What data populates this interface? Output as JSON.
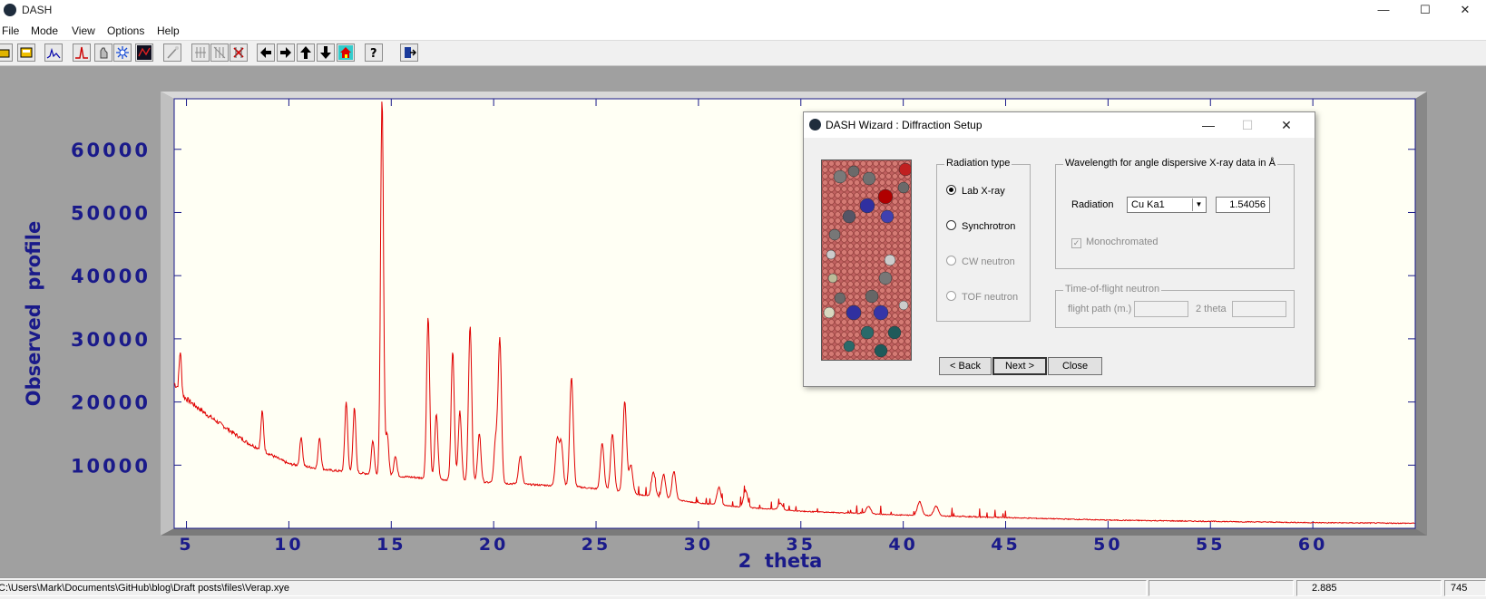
{
  "window": {
    "title": "DASH",
    "minimize": "—",
    "maximize": "☐",
    "close": "✕"
  },
  "menu": [
    "File",
    "Mode",
    "View",
    "Options",
    "Help"
  ],
  "toolbar": {
    "icons": [
      "open-folder-icon",
      "open-file-icon",
      "profile-chart-icon",
      "peak-fit-icon",
      "pawley-icon",
      "crystal-structure-icon",
      "structure-view-icon",
      "wand-icon",
      "grid-icon",
      "grid-cancel-icon",
      "grid-delete-icon",
      "arrow-left-icon",
      "arrow-right-icon",
      "arrow-up-icon",
      "arrow-down-icon",
      "home-icon",
      "help-icon",
      "exit-icon"
    ]
  },
  "chart_data": {
    "type": "line",
    "xlabel": "2  theta",
    "ylabel": "Observed  profile",
    "xlim": [
      4.4,
      65
    ],
    "ylim": [
      0,
      68000
    ],
    "xticks": [
      "5",
      "10",
      "15",
      "20",
      "25",
      "30",
      "35",
      "40",
      "45",
      "50",
      "55",
      "60"
    ],
    "yticks": [
      "10000",
      "20000",
      "30000",
      "40000",
      "50000",
      "60000"
    ],
    "series": [
      {
        "color": "#e00000",
        "background": [
          [
            4.4,
            23000
          ],
          [
            4.8,
            21000
          ],
          [
            6,
            18000
          ],
          [
            8,
            13500
          ],
          [
            10,
            10200
          ],
          [
            12,
            9200
          ],
          [
            14,
            8600
          ],
          [
            16,
            8100
          ],
          [
            18,
            7600
          ],
          [
            20,
            7200
          ],
          [
            22,
            6900
          ],
          [
            24,
            6600
          ],
          [
            26,
            5900
          ],
          [
            28,
            4900
          ],
          [
            30,
            4000
          ],
          [
            32,
            3400
          ],
          [
            35,
            2700
          ],
          [
            40,
            2100
          ],
          [
            45,
            1700
          ],
          [
            50,
            1300
          ],
          [
            55,
            1100
          ],
          [
            60,
            900
          ],
          [
            65,
            800
          ]
        ],
        "peaks": [
          [
            4.7,
            28000
          ],
          [
            8.7,
            18500
          ],
          [
            10.6,
            14500
          ],
          [
            11.5,
            14400
          ],
          [
            12.8,
            20000
          ],
          [
            13.2,
            19000
          ],
          [
            14.1,
            14000
          ],
          [
            14.55,
            68000
          ],
          [
            14.8,
            15000
          ],
          [
            15.2,
            11500
          ],
          [
            16.8,
            33500
          ],
          [
            17.2,
            18000
          ],
          [
            18.0,
            28000
          ],
          [
            18.35,
            18500
          ],
          [
            18.85,
            32000
          ],
          [
            19.3,
            15000
          ],
          [
            20.1,
            14000
          ],
          [
            20.3,
            30000
          ],
          [
            21.3,
            11500
          ],
          [
            23.1,
            14000
          ],
          [
            23.3,
            13500
          ],
          [
            23.8,
            24000
          ],
          [
            25.3,
            13500
          ],
          [
            25.8,
            15000
          ],
          [
            26.4,
            20000
          ],
          [
            26.7,
            10000
          ],
          [
            27.8,
            9000
          ],
          [
            28.3,
            8500
          ],
          [
            28.8,
            9000
          ],
          [
            31.0,
            6500
          ],
          [
            32.3,
            6000
          ],
          [
            34.0,
            4000
          ],
          [
            38.3,
            3500
          ],
          [
            40.8,
            4200
          ],
          [
            41.6,
            3500
          ]
        ]
      }
    ]
  },
  "status": {
    "path": "C:\\Users\\Mark\\Documents\\GitHub\\blog\\Draft posts\\files\\Verap.xye",
    "value1": "2.885",
    "value2": "745"
  },
  "dialog": {
    "title": "DASH Wizard : Diffraction Setup",
    "radiation_group": "Radiation type",
    "radiation_options": [
      {
        "label": "Lab X-ray",
        "selected": true,
        "enabled": true
      },
      {
        "label": "Synchrotron",
        "selected": false,
        "enabled": true
      },
      {
        "label": "CW neutron",
        "selected": false,
        "enabled": false
      },
      {
        "label": "TOF neutron",
        "selected": false,
        "enabled": false
      }
    ],
    "wavelength_group": "Wavelength for angle dispersive  X-ray data in Å",
    "radiation_label": "Radiation",
    "radiation_select": "Cu Ka1",
    "wavelength_value": "1.54056",
    "monochromated": "Monochromated",
    "tof_group": "Time-of-flight neutron",
    "flight_path_label": "flight path (m.)",
    "two_theta_label": "2 theta",
    "buttons": {
      "back": "< Back",
      "next": "Next >",
      "close": "Close"
    }
  }
}
